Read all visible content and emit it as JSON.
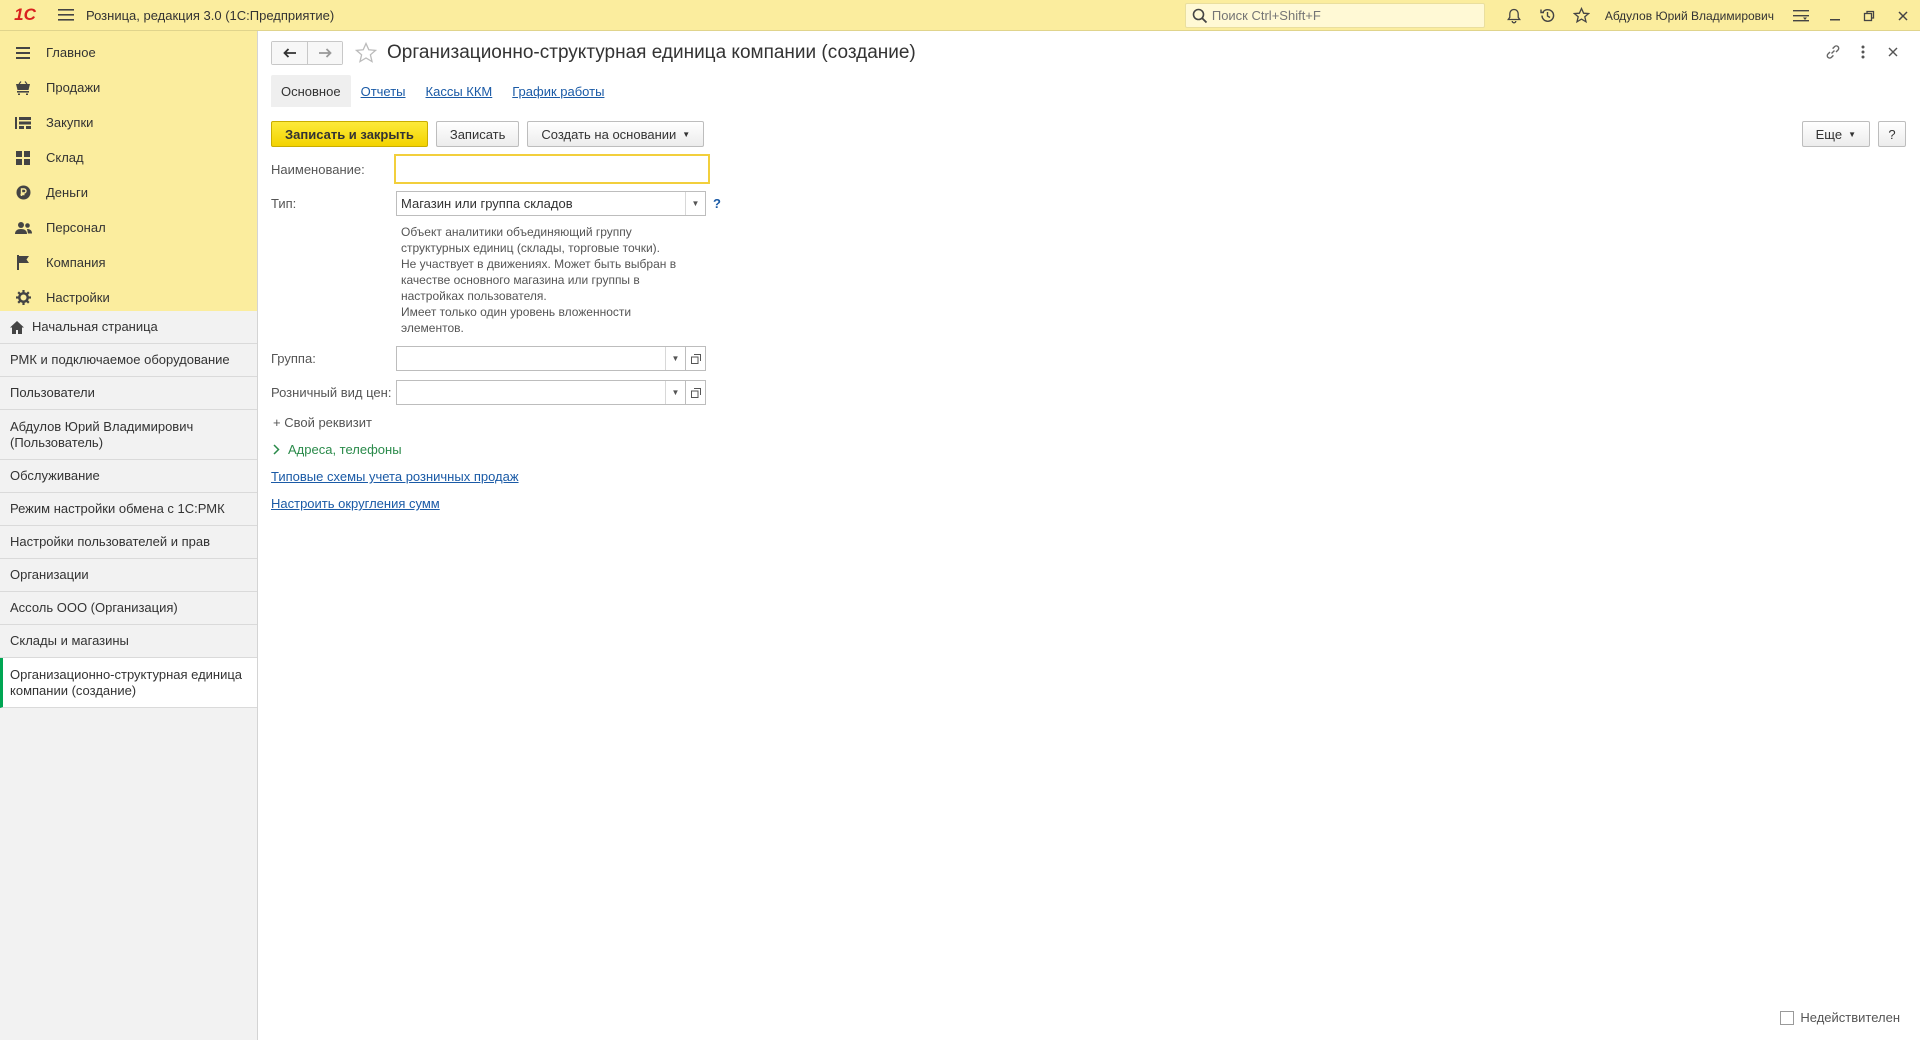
{
  "app": {
    "logo": "1С",
    "title": "Розница, редакция 3.0  (1С:Предприятие)",
    "search_placeholder": "Поиск Ctrl+Shift+F",
    "user": "Абдулов Юрий Владимирович"
  },
  "sections": [
    {
      "label": "Главное",
      "icon": "menu-lines-icon"
    },
    {
      "label": "Продажи",
      "icon": "cart-icon"
    },
    {
      "label": "Закупки",
      "icon": "purchase-icon"
    },
    {
      "label": "Склад",
      "icon": "warehouse-grid-icon"
    },
    {
      "label": "Деньги",
      "icon": "money-icon"
    },
    {
      "label": "Персонал",
      "icon": "people-icon"
    },
    {
      "label": "Компания",
      "icon": "flag-icon"
    },
    {
      "label": "Настройки",
      "icon": "gear-icon"
    }
  ],
  "open_windows": [
    {
      "label": "Начальная страница",
      "icon": "home-icon"
    },
    {
      "label": "РМК и подключаемое оборудование"
    },
    {
      "label": "Пользователи"
    },
    {
      "label": "Абдулов Юрий Владимирович (Пользователь)"
    },
    {
      "label": "Обслуживание"
    },
    {
      "label": "Режим настройки обмена с 1С:РМК"
    },
    {
      "label": "Настройки пользователей и прав"
    },
    {
      "label": "Организации"
    },
    {
      "label": "Ассоль ООО (Организация)"
    },
    {
      "label": "Склады и магазины"
    },
    {
      "label": "Организационно-структурная единица компании (создание)",
      "active": true
    }
  ],
  "form": {
    "title": "Организационно-структурная единица компании (создание)",
    "tabs": [
      "Основное",
      "Отчеты",
      "Кассы ККМ",
      "График работы"
    ],
    "buttons": {
      "save_close": "Записать и закрыть",
      "save": "Записать",
      "create_based": "Создать на основании",
      "more": "Еще",
      "help": "?"
    },
    "fields": {
      "name_label": "Наименование:",
      "name_value": "",
      "type_label": "Тип:",
      "type_value": "Магазин или группа складов",
      "type_help": "?",
      "type_description": [
        "Объект аналитики объединяющий группу",
        "структурных единиц (склады, торговые точки).",
        "Не участвует в движениях. Может быть выбран в",
        "качестве основного магазина или группы в",
        "настройках пользователя.",
        "Имеет только один уровень вложенности",
        "элементов."
      ],
      "group_label": "Группа:",
      "group_value": "",
      "price_label": "Розничный вид цен:",
      "price_value": ""
    },
    "add_prop": "+ Свой реквизит",
    "addresses_group": "Адреса, телефоны",
    "links": {
      "schemes": "Типовые схемы учета розничных продаж",
      "rounding": "Настроить округления сумм"
    },
    "inactive_label": "Недействителен"
  },
  "colors": {
    "accent_yellow": "#fbed9e",
    "primary_button": "#f3d300",
    "link": "#1a5aa6",
    "active_marker": "#00a653"
  }
}
